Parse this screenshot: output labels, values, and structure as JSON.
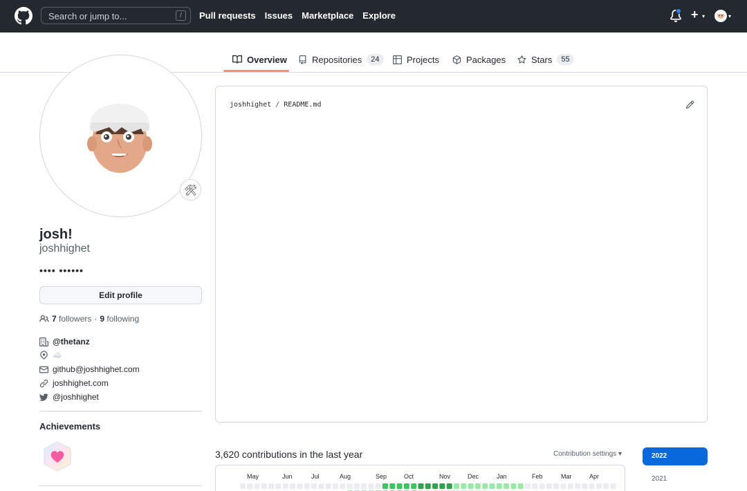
{
  "header": {
    "search_placeholder": "Search or jump to...",
    "search_shortcut": "/",
    "nav": [
      "Pull requests",
      "Issues",
      "Marketplace",
      "Explore"
    ],
    "plus_label": "+"
  },
  "tabs": [
    {
      "label": "Overview",
      "count": null,
      "selected": true
    },
    {
      "label": "Repositories",
      "count": "24",
      "selected": false
    },
    {
      "label": "Projects",
      "count": null,
      "selected": false
    },
    {
      "label": "Packages",
      "count": null,
      "selected": false
    },
    {
      "label": "Stars",
      "count": "55",
      "selected": false
    }
  ],
  "profile": {
    "status_emoji": "🛠",
    "display_name": "josh!",
    "login": "joshhighet",
    "bio": "•••• ••••••",
    "edit_button": "Edit profile",
    "followers_count": "7",
    "followers_label": "followers",
    "dot": "·",
    "following_count": "9",
    "following_label": "following",
    "company": "@thetanz",
    "location": "☁️",
    "email": "github@joshhighet.com",
    "website": "joshhighet.com",
    "twitter": "@joshhighet",
    "achievements_title": "Achievements"
  },
  "readme": {
    "owner": "joshhighet",
    "slash": " / ",
    "file": "README.md"
  },
  "contributions": {
    "summary": "3,620 contributions in the last year",
    "settings_label": "Contribution settings ▾",
    "months": [
      "May",
      "Jun",
      "Jul",
      "Aug",
      "Sep",
      "Oct",
      "Nov",
      "Dec",
      "Jan",
      "Feb",
      "Mar",
      "Apr"
    ],
    "years": [
      "2022",
      "2021"
    ],
    "colors": {
      "l0": "#ebedf0",
      "l1": "#9be9a8",
      "l2": "#40c463",
      "l3": "#30a14e",
      "l4": "#216e39"
    }
  }
}
